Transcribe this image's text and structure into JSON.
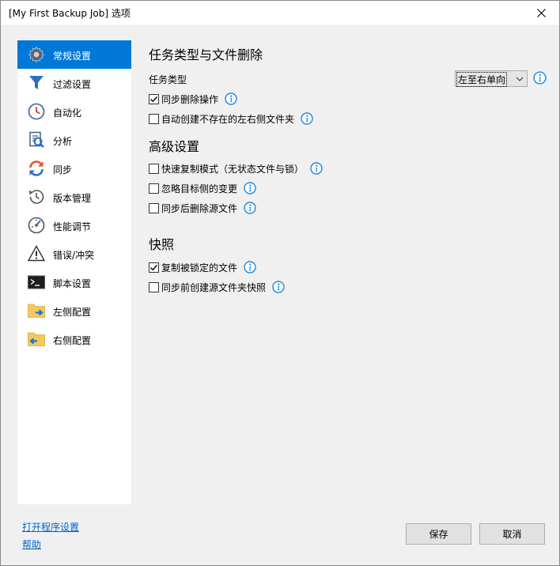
{
  "window": {
    "title": "[My First Backup Job] 选项"
  },
  "sidebar": {
    "items": [
      {
        "label": "常规设置",
        "icon": "gear-icon",
        "active": true
      },
      {
        "label": "过滤设置",
        "icon": "filter-icon",
        "active": false
      },
      {
        "label": "自动化",
        "icon": "clock-icon",
        "active": false
      },
      {
        "label": "分析",
        "icon": "analyze-icon",
        "active": false
      },
      {
        "label": "同步",
        "icon": "sync-icon",
        "active": false
      },
      {
        "label": "版本管理",
        "icon": "history-icon",
        "active": false
      },
      {
        "label": "性能调节",
        "icon": "gauge-icon",
        "active": false
      },
      {
        "label": "错误/冲突",
        "icon": "warning-icon",
        "active": false
      },
      {
        "label": "脚本设置",
        "icon": "terminal-icon",
        "active": false
      },
      {
        "label": "左侧配置",
        "icon": "folder-right-arrow-icon",
        "active": false
      },
      {
        "label": "右侧配置",
        "icon": "folder-left-arrow-icon",
        "active": false
      }
    ]
  },
  "links": {
    "open_program_settings": "打开程序设置",
    "help": "帮助"
  },
  "main": {
    "section1": {
      "title": "任务类型与文件删除",
      "task_type_label": "任务类型",
      "task_type_value": "左至右单向",
      "options": [
        {
          "label": "同步删除操作",
          "checked": true
        },
        {
          "label": "自动创建不存在的左右侧文件夹",
          "checked": false
        }
      ]
    },
    "section2": {
      "title": "高级设置",
      "options": [
        {
          "label": "快速复制模式（无状态文件与锁）",
          "checked": false
        },
        {
          "label": "忽略目标侧的变更",
          "checked": false
        },
        {
          "label": "同步后删除源文件",
          "checked": false
        }
      ]
    },
    "section3": {
      "title": "快照",
      "options": [
        {
          "label": "复制被锁定的文件",
          "checked": true
        },
        {
          "label": "同步前创建源文件夹快照",
          "checked": false
        }
      ]
    }
  },
  "buttons": {
    "save": "保存",
    "cancel": "取消"
  },
  "colors": {
    "accent": "#0078d7",
    "info_icon": "#1e88e5",
    "link": "#0066cc"
  }
}
